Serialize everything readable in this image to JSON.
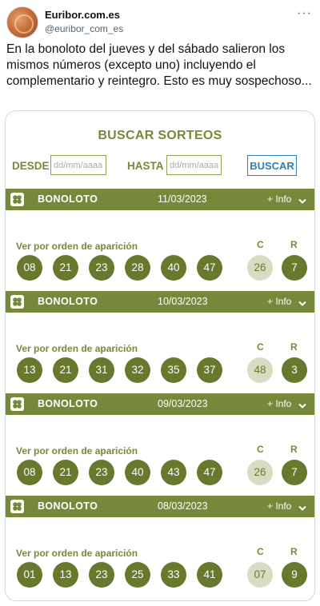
{
  "tweet": {
    "display_name": "Euribor.com.es",
    "handle": "@euribor_com_es",
    "more_label": "···",
    "text": "En la bonoloto del jueves y del sábado salieron los mismos números (excepto uno) incluyendo el complementario y reintegro. Esto es muy sospechoso..."
  },
  "search": {
    "title": "BUSCAR SORTEOS",
    "from_label": "DESDE",
    "to_label": "HASTA",
    "date_placeholder": "dd/mm/aaaa",
    "button_label": "BUSCAR"
  },
  "draws": [
    {
      "name": "BONOLOTO",
      "date": "11/03/2023",
      "info_label": "+ Info",
      "order_label": "Ver por orden de aparición",
      "numbers": [
        "08",
        "21",
        "23",
        "28",
        "40",
        "47"
      ],
      "c_label": "C",
      "r_label": "R",
      "complementario": "26",
      "reintegro": "7"
    },
    {
      "name": "BONOLOTO",
      "date": "10/03/2023",
      "info_label": "+ Info",
      "order_label": "Ver por orden de aparición",
      "numbers": [
        "13",
        "21",
        "31",
        "32",
        "35",
        "37"
      ],
      "c_label": "C",
      "r_label": "R",
      "complementario": "48",
      "reintegro": "3"
    },
    {
      "name": "BONOLOTO",
      "date": "09/03/2023",
      "info_label": "+ Info",
      "order_label": "Ver por orden de aparición",
      "numbers": [
        "08",
        "21",
        "23",
        "40",
        "43",
        "47"
      ],
      "c_label": "C",
      "r_label": "R",
      "complementario": "26",
      "reintegro": "7"
    },
    {
      "name": "BONOLOTO",
      "date": "08/03/2023",
      "info_label": "+ Info",
      "order_label": "Ver por orden de aparición",
      "numbers": [
        "01",
        "13",
        "23",
        "25",
        "33",
        "41"
      ],
      "c_label": "C",
      "r_label": "R",
      "complementario": "07",
      "reintegro": "9"
    }
  ],
  "colors": {
    "brand_green": "#76893a",
    "ball_green": "#68782c",
    "complementario_bg": "#d9dcc2",
    "button_blue": "#2d7fb8"
  },
  "icons": {
    "draw_icon": "clover-icon",
    "expand_icon": "chevron-down-icon",
    "menu_icon": "more-icon"
  }
}
